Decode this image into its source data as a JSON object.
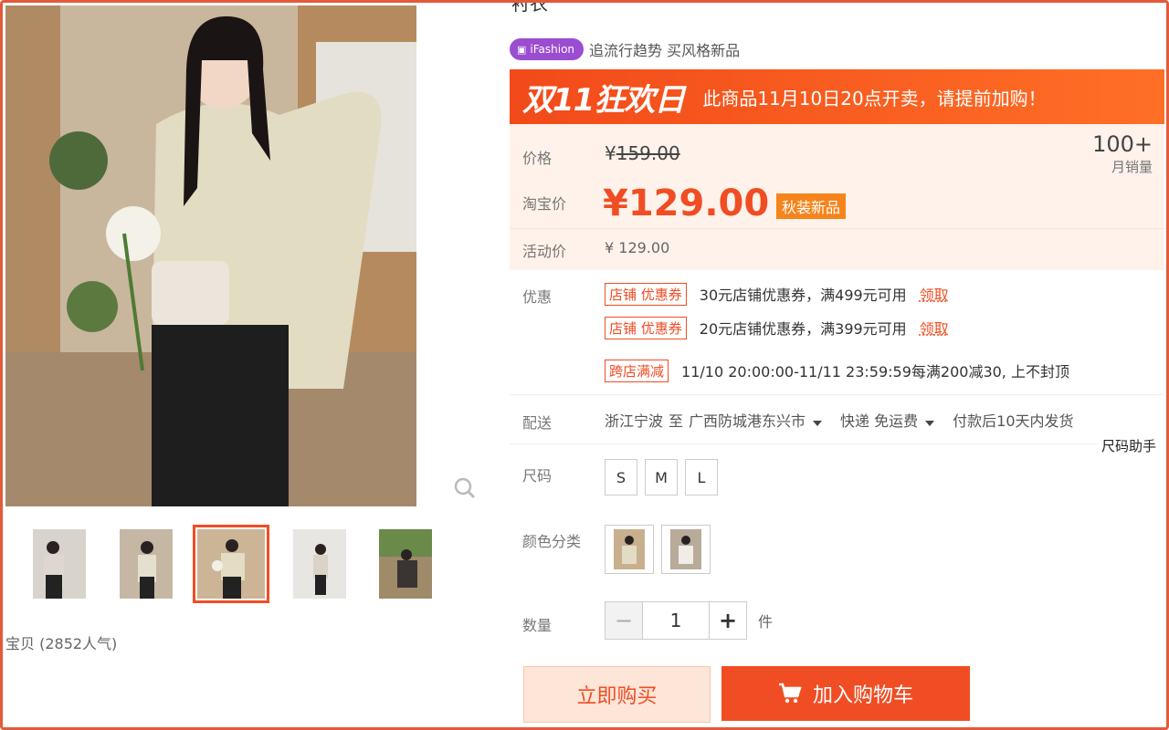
{
  "title_fragment": "衬衣",
  "brand": {
    "badge": "iFashion",
    "slogan": "追流行趋势 买风格新品",
    "color": "#9b4dd1"
  },
  "banner": {
    "logo": "双11狂欢日",
    "notice": "此商品11月10日20点开卖，请提前加购！"
  },
  "price": {
    "label": "价格",
    "original": "159.00",
    "currency": "¥",
    "taobao_label": "淘宝价",
    "taobao_price": "129.00",
    "tag": "秋装新品",
    "activity_label": "活动价",
    "activity_price": "¥ 129.00",
    "sales_count": "100+",
    "sales_label": "月销量"
  },
  "promo": {
    "label": "优惠",
    "coupons": [
      {
        "tag": "店铺 优惠券",
        "text": "30元店铺优惠券，满499元可用",
        "claim": "领取"
      },
      {
        "tag": "店铺 优惠券",
        "text": "20元店铺优惠券，满399元可用",
        "claim": "领取"
      }
    ],
    "cross": {
      "tag": "跨店满减",
      "text": "11/10 20:00:00-11/11 23:59:59每满200减30, 上不封顶"
    }
  },
  "delivery": {
    "label": "配送",
    "from": "浙江宁波",
    "to_word": "至",
    "to": "广西防城港东兴市",
    "method": "快递 免运费",
    "ship": "付款后10天内发货"
  },
  "size_help": "尺码助手",
  "size": {
    "label": "尺码",
    "options": [
      "S",
      "M",
      "L"
    ]
  },
  "color": {
    "label": "颜色分类"
  },
  "quantity": {
    "label": "数量",
    "value": "1",
    "unit": "件",
    "minus": "−",
    "plus": "+"
  },
  "buttons": {
    "buy_now": "立即购买",
    "add_cart": "加入购物车"
  },
  "popularity": "宝贝 (2852人气)",
  "accent": "#f04d24"
}
